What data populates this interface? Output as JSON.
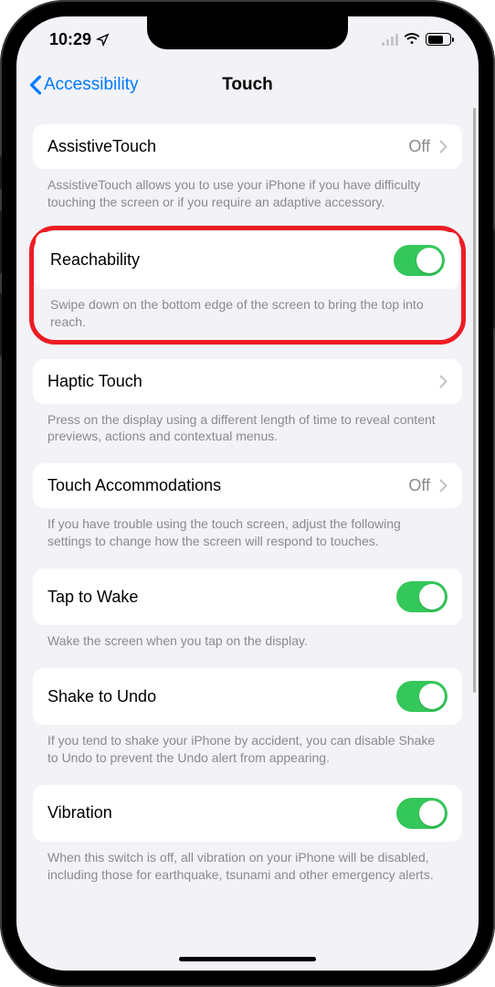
{
  "statusbar": {
    "time": "10:29"
  },
  "nav": {
    "back": "Accessibility",
    "title": "Touch"
  },
  "rows": {
    "assistive": {
      "label": "AssistiveTouch",
      "value": "Off",
      "desc": "AssistiveTouch allows you to use your iPhone if you have difficulty touching the screen or if you require an adaptive accessory."
    },
    "reachability": {
      "label": "Reachability",
      "desc": "Swipe down on the bottom edge of the screen to bring the top into reach."
    },
    "haptic": {
      "label": "Haptic Touch",
      "desc": "Press on the display using a different length of time to reveal content previews, actions and contextual menus."
    },
    "accommodations": {
      "label": "Touch Accommodations",
      "value": "Off",
      "desc": "If you have trouble using the touch screen, adjust the following settings to change how the screen will respond to touches."
    },
    "taptowake": {
      "label": "Tap to Wake",
      "desc": "Wake the screen when you tap on the display."
    },
    "shake": {
      "label": "Shake to Undo",
      "desc": "If you tend to shake your iPhone by accident, you can disable Shake to Undo to prevent the Undo alert from appearing."
    },
    "vibration": {
      "label": "Vibration",
      "desc": "When this switch is off, all vibration on your iPhone will be disabled, including those for earthquake, tsunami and other emergency alerts."
    }
  }
}
